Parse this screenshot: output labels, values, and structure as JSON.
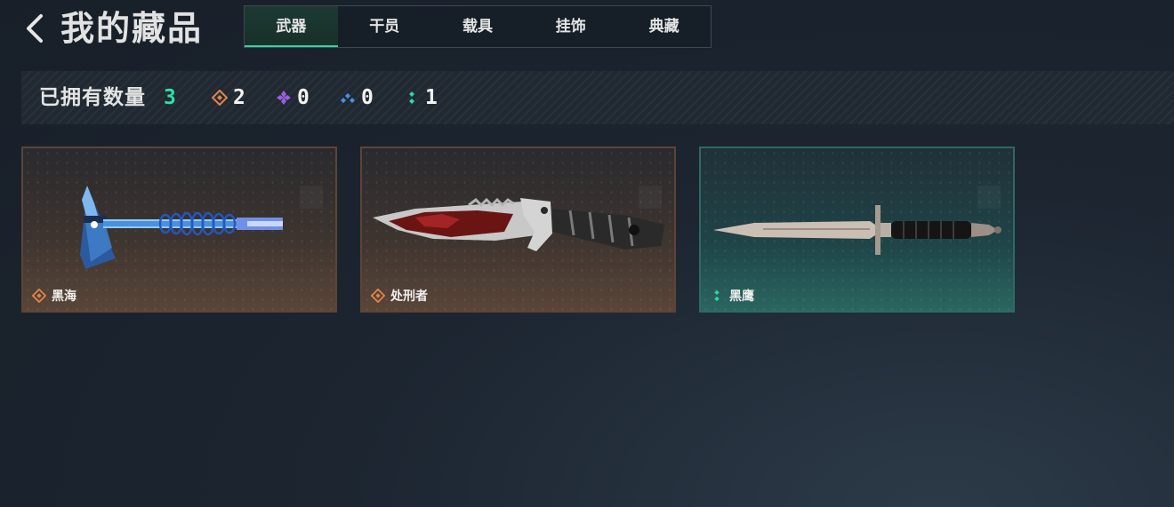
{
  "header": {
    "title": "我的藏品",
    "tabs": [
      {
        "label": "武器",
        "active": true
      },
      {
        "label": "干员",
        "active": false
      },
      {
        "label": "载具",
        "active": false
      },
      {
        "label": "挂饰",
        "active": false
      },
      {
        "label": "典藏",
        "active": false
      }
    ]
  },
  "summary": {
    "owned_label": "已拥有数量",
    "owned_count": "3",
    "rarity_counts": [
      {
        "icon": "orange-diamond-icon",
        "color": "#e0874a",
        "count": "2"
      },
      {
        "icon": "purple-diamond-icon",
        "color": "#9a5ee0",
        "count": "0"
      },
      {
        "icon": "blue-diamond-icon",
        "color": "#4b8fe0",
        "count": "0"
      },
      {
        "icon": "green-dots-icon",
        "color": "#2fd6a3",
        "count": "1"
      }
    ]
  },
  "items": [
    {
      "name": "黑海",
      "rarity_icon": "orange-diamond-icon",
      "weapon_icon": "tomahawk-icon"
    },
    {
      "name": "处刑者",
      "rarity_icon": "orange-diamond-icon",
      "weapon_icon": "combat-knife-icon"
    },
    {
      "name": "黑鹰",
      "rarity_icon": "green-dots-icon",
      "weapon_icon": "dagger-icon"
    }
  ],
  "colors": {
    "accent": "#2fd6a3",
    "legendary": "#e0874a",
    "epic": "#9a5ee0",
    "rare": "#4b8fe0",
    "uncommon": "#2fd6a3"
  }
}
